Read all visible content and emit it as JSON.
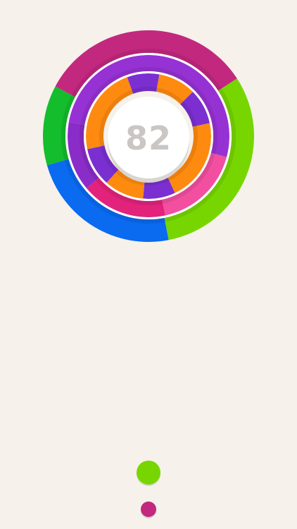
{
  "game": {
    "score": "82",
    "background_color": "#f6f1ea",
    "rings": [
      {
        "name": "outer-ring",
        "segments": [
          {
            "color": "#c2287e",
            "from": -62,
            "to": 57
          },
          {
            "color": "#77d600",
            "from": 57,
            "to": 169
          },
          {
            "color": "#0a6af0",
            "from": 169,
            "to": 254
          },
          {
            "color": "#13bd2b",
            "from": 254,
            "to": 298
          }
        ]
      },
      {
        "name": "middle-ring",
        "segments": [
          {
            "color": "#9632d4",
            "from": -80,
            "to": 105
          },
          {
            "color": "#f24fa0",
            "from": 105,
            "to": 168
          },
          {
            "color": "#e3227c",
            "from": 168,
            "to": 230
          },
          {
            "color": "#8a2cc8",
            "from": 230,
            "to": 280
          }
        ]
      },
      {
        "name": "inner-ring",
        "segments": [
          {
            "color": "#7b2fd1",
            "from": -20,
            "to": 10
          },
          {
            "color": "#ff8a10",
            "from": 10,
            "to": 45
          },
          {
            "color": "#7b2fd1",
            "from": 45,
            "to": 78
          },
          {
            "color": "#ff8a10",
            "from": 78,
            "to": 155
          },
          {
            "color": "#7b2fd1",
            "from": 155,
            "to": 185
          },
          {
            "color": "#ff8a10",
            "from": 185,
            "to": 222
          },
          {
            "color": "#7b2fd1",
            "from": 222,
            "to": 258
          },
          {
            "color": "#ff8a10",
            "from": 258,
            "to": 340
          }
        ]
      }
    ],
    "balls": [
      {
        "name": "active-ball",
        "color": "#77d600"
      },
      {
        "name": "next-ball",
        "color": "#c2287e"
      }
    ]
  }
}
